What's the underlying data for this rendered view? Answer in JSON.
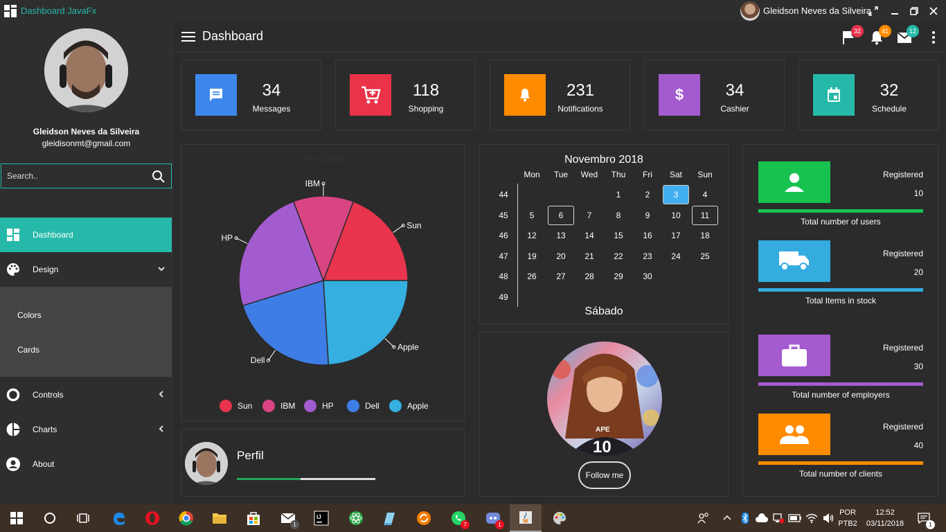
{
  "window": {
    "app_title": "Dashboard JavaFx",
    "user_name": "Gleidson Neves da Silveira"
  },
  "sidebar": {
    "user_name": "Gleidson Neves da Silveira",
    "user_email": "gleidisonmt@gmail.com",
    "search_placeholder": "Search..",
    "items": [
      {
        "label": "Dashboard",
        "icon": "dashboard-icon",
        "active": true
      },
      {
        "label": "Design",
        "icon": "palette-icon",
        "expanded": true
      },
      {
        "label": "Controls",
        "icon": "circle-icon"
      },
      {
        "label": "Charts",
        "icon": "pie-icon"
      },
      {
        "label": "About",
        "icon": "account-icon"
      }
    ],
    "submenu": [
      {
        "label": "Colors"
      },
      {
        "label": "Cards"
      }
    ]
  },
  "header": {
    "title": "Dashboard",
    "badges": {
      "flags": "32",
      "notifications": "41",
      "messages": "12"
    }
  },
  "stats": [
    {
      "value": "34",
      "label": "Messages",
      "color": "#3d87ec",
      "icon": "message-icon"
    },
    {
      "value": "118",
      "label": "Shopping",
      "color": "#ea3248",
      "icon": "cart-icon"
    },
    {
      "value": "231",
      "label": "Notifications",
      "color": "#ff8c00",
      "icon": "bell-icon"
    },
    {
      "value": "34",
      "label": "Cashier",
      "color": "#a45bd0",
      "icon": "dollar-icon"
    },
    {
      "value": "32",
      "label": "Schedule",
      "color": "#26b9a9",
      "icon": "calendar-icon"
    }
  ],
  "pie": {
    "title": "Pie Chart",
    "slices": [
      {
        "name": "Sun",
        "value": 20,
        "color": "#e8344c"
      },
      {
        "name": "IBM",
        "value": 12,
        "color": "#d94583"
      },
      {
        "name": "HP",
        "value": 25,
        "color": "#a35bd0"
      },
      {
        "name": "Dell",
        "value": 22,
        "color": "#3f7de6"
      },
      {
        "name": "Apple",
        "value": 25,
        "color": "#35aee0"
      }
    ]
  },
  "calendar": {
    "month": "Novembro 2018",
    "days": [
      "Mon",
      "Tue",
      "Wed",
      "Thu",
      "Fri",
      "Sat",
      "Sun"
    ],
    "weeks": [
      {
        "num": "44",
        "dates": [
          "",
          "",
          "",
          "1",
          "2",
          "3",
          "4"
        ]
      },
      {
        "num": "45",
        "dates": [
          "5",
          "6",
          "7",
          "8",
          "9",
          "10",
          "11"
        ]
      },
      {
        "num": "46",
        "dates": [
          "12",
          "13",
          "14",
          "15",
          "16",
          "17",
          "18"
        ]
      },
      {
        "num": "47",
        "dates": [
          "19",
          "20",
          "21",
          "22",
          "23",
          "24",
          "25"
        ]
      },
      {
        "num": "48",
        "dates": [
          "26",
          "27",
          "28",
          "29",
          "30",
          "",
          ""
        ]
      },
      {
        "num": "49",
        "dates": [
          "",
          "",
          "",
          "",
          "",
          "",
          ""
        ]
      }
    ],
    "selected": "3",
    "marked": [
      "6",
      "11"
    ],
    "day_name": "Sábado"
  },
  "follow": {
    "button": "Follow me"
  },
  "perfil": {
    "title": "Perfil",
    "progress": 0.46
  },
  "registered": [
    {
      "label": "Registered",
      "value": "10",
      "caption": "Total number of users",
      "color": "#17c24f",
      "icon": "person-icon"
    },
    {
      "label": "Registered",
      "value": "20",
      "caption": "Total Items in stock",
      "color": "#34ace0",
      "icon": "truck-icon"
    },
    {
      "label": "Registered",
      "value": "30",
      "caption": "Total number of employers",
      "color": "#a45bd0",
      "icon": "briefcase-icon"
    },
    {
      "label": "Registered",
      "value": "40",
      "caption": "Total number of clients",
      "color": "#ff8c00",
      "icon": "people-icon"
    }
  ],
  "taskbar": {
    "lang": "POR",
    "layout": "PTB2",
    "time": "12:52",
    "date": "03/11/2018",
    "badges": {
      "mail": "1",
      "whatsapp": "7",
      "discord": "1",
      "notifications": "1"
    }
  }
}
